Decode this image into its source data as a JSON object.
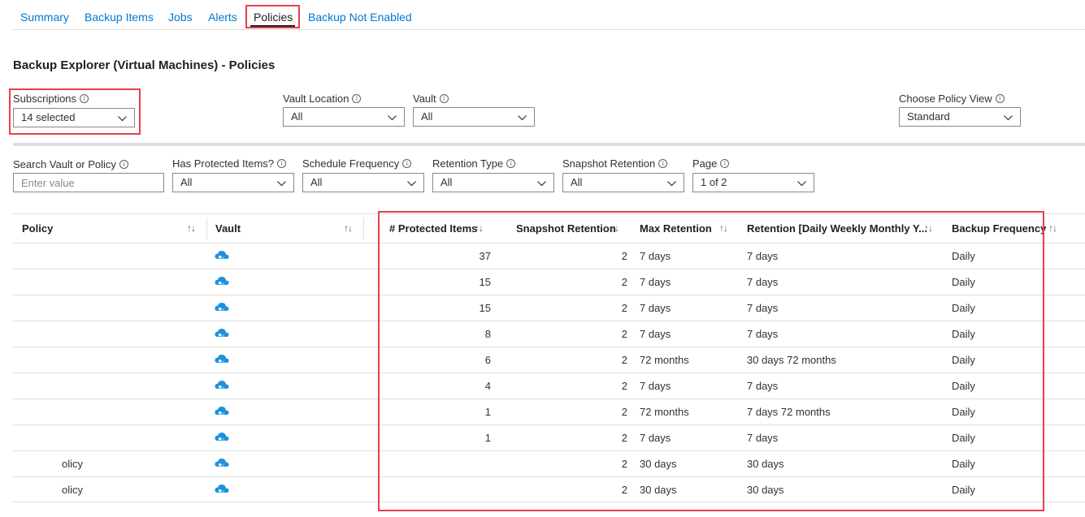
{
  "tabs": [
    {
      "label": "Summary"
    },
    {
      "label": "Backup Items"
    },
    {
      "label": "Jobs"
    },
    {
      "label": "Alerts"
    },
    {
      "label": "Policies"
    },
    {
      "label": "Backup Not Enabled"
    }
  ],
  "page_title": "Backup Explorer (Virtual Machines) - Policies",
  "filters_top": {
    "subscriptions": {
      "label": "Subscriptions",
      "value": "14 selected"
    },
    "vault_location": {
      "label": "Vault Location",
      "value": "All"
    },
    "vault": {
      "label": "Vault",
      "value": "All"
    },
    "policy_view": {
      "label": "Choose Policy View",
      "value": "Standard"
    }
  },
  "filters_bottom": {
    "search": {
      "label": "Search Vault or Policy",
      "placeholder": "Enter value"
    },
    "has_protected": {
      "label": "Has Protected Items?",
      "value": "All"
    },
    "schedule_frequency": {
      "label": "Schedule Frequency",
      "value": "All"
    },
    "retention_type": {
      "label": "Retention Type",
      "value": "All"
    },
    "snapshot_retention": {
      "label": "Snapshot Retention",
      "value": "All"
    },
    "page": {
      "label": "Page",
      "value": "1 of 2"
    }
  },
  "icons": {
    "info": "info-icon",
    "chevron": "chevron-down-icon",
    "sort": "sort-icon",
    "vault": "backup-vault-cloud-icon"
  },
  "colors": {
    "link": "#0078d4",
    "highlight": "#e8414a",
    "vault_icon": "#1e90e0"
  },
  "table": {
    "columns": [
      {
        "label": "Policy"
      },
      {
        "label": "Vault"
      },
      {
        "label": "# Protected Items"
      },
      {
        "label": "Snapshot Retention"
      },
      {
        "label": "Max Retention"
      },
      {
        "label": "Retention [Daily Weekly Monthly Y..."
      },
      {
        "label": "Backup Frequency"
      }
    ],
    "sort_glyph": "↑↓",
    "rows": [
      {
        "policy": "",
        "vault": "",
        "protected": "37",
        "snapshot": "2",
        "max": "7 days",
        "retention": "7 days",
        "frequency": "Daily"
      },
      {
        "policy": "",
        "vault": "",
        "protected": "15",
        "snapshot": "2",
        "max": "7 days",
        "retention": "7 days",
        "frequency": "Daily"
      },
      {
        "policy": "",
        "vault": "",
        "protected": "15",
        "snapshot": "2",
        "max": "7 days",
        "retention": "7 days",
        "frequency": "Daily"
      },
      {
        "policy": "",
        "vault": "",
        "protected": "8",
        "snapshot": "2",
        "max": "7 days",
        "retention": "7 days",
        "frequency": "Daily"
      },
      {
        "policy": "",
        "vault": "",
        "protected": "6",
        "snapshot": "2",
        "max": "72 months",
        "retention": "30 days 72 months",
        "frequency": "Daily"
      },
      {
        "policy": "",
        "vault": "",
        "protected": "4",
        "snapshot": "2",
        "max": "7 days",
        "retention": "7 days",
        "frequency": "Daily"
      },
      {
        "policy": "",
        "vault": "",
        "protected": "1",
        "snapshot": "2",
        "max": "72 months",
        "retention": "7 days 72 months",
        "frequency": "Daily"
      },
      {
        "policy": "",
        "vault": "",
        "protected": "1",
        "snapshot": "2",
        "max": "7 days",
        "retention": "7 days",
        "frequency": "Daily"
      },
      {
        "policy": "olicy",
        "vault": "",
        "protected": "",
        "snapshot": "2",
        "max": "30 days",
        "retention": "30 days",
        "frequency": "Daily"
      },
      {
        "policy": "olicy",
        "vault": "",
        "protected": "",
        "snapshot": "2",
        "max": "30 days",
        "retention": "30 days",
        "frequency": "Daily"
      }
    ]
  }
}
